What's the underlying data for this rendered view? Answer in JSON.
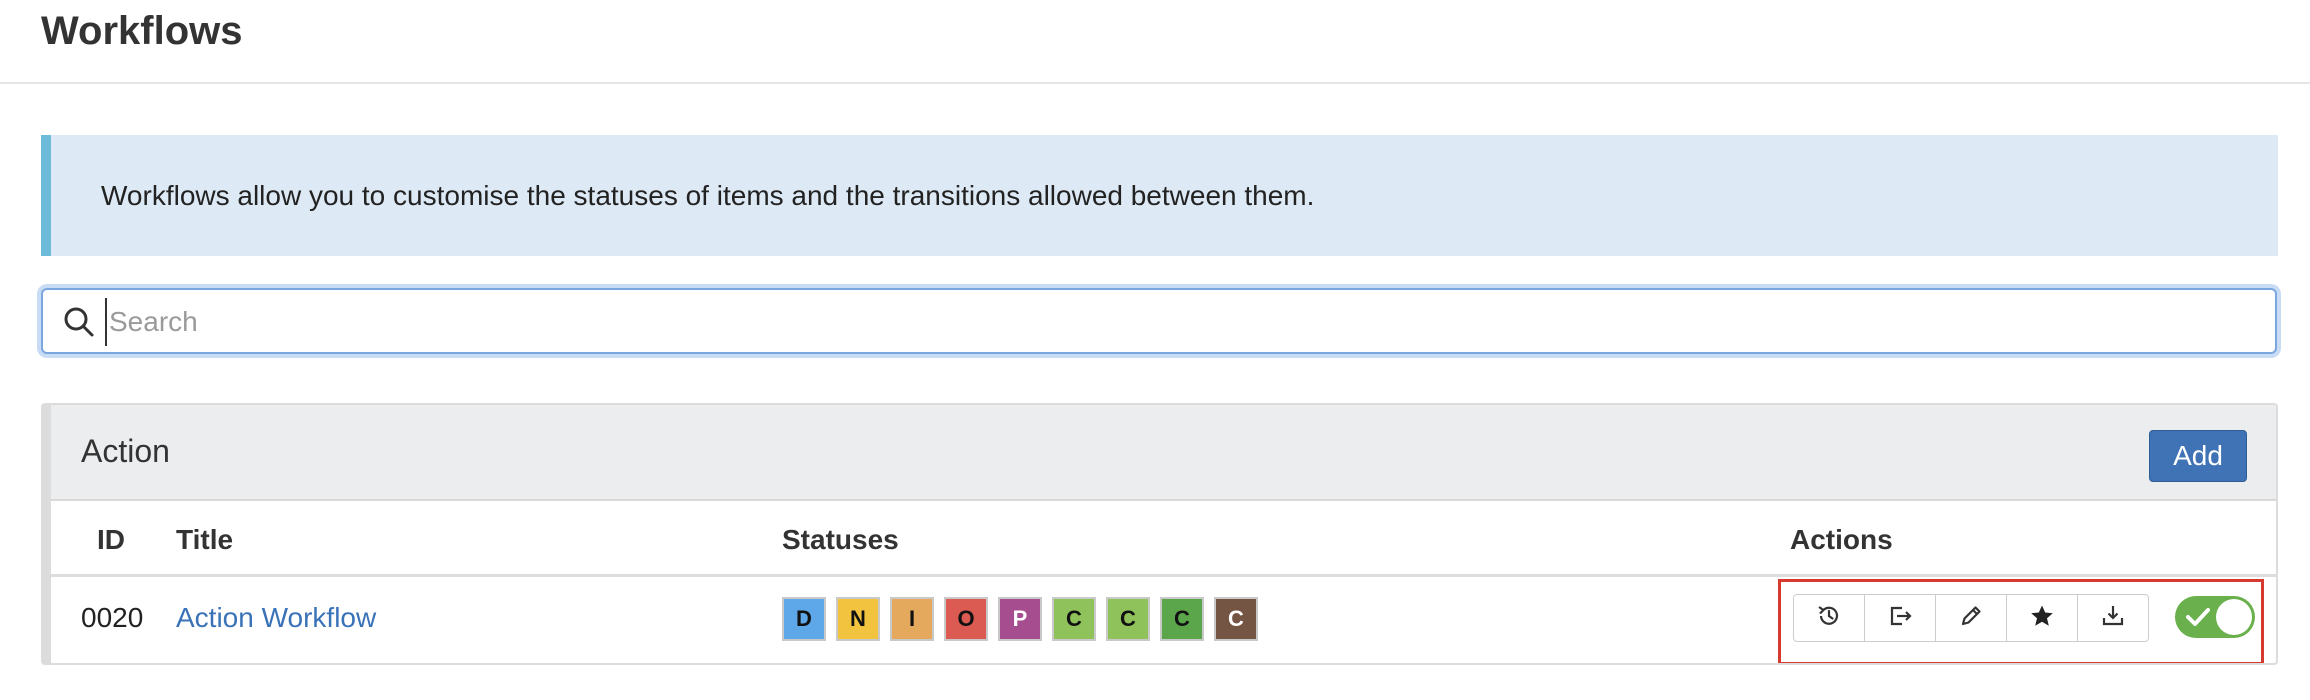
{
  "page": {
    "title": "Workflows"
  },
  "info": {
    "text": "Workflows allow you to customise the statuses of items and the transitions allowed between them."
  },
  "search": {
    "placeholder": "Search",
    "value": ""
  },
  "panel": {
    "title": "Action",
    "add_label": "Add",
    "columns": {
      "id": "ID",
      "title": "Title",
      "statuses": "Statuses",
      "actions": "Actions"
    },
    "rows": [
      {
        "id": "0020",
        "title": "Action Workflow",
        "statuses": [
          {
            "letter": "D",
            "bg": "#5ea7e8",
            "fg": "#111111"
          },
          {
            "letter": "N",
            "bg": "#f2c33f",
            "fg": "#111111"
          },
          {
            "letter": "I",
            "bg": "#e5a95e",
            "fg": "#111111"
          },
          {
            "letter": "O",
            "bg": "#db5a51",
            "fg": "#111111"
          },
          {
            "letter": "P",
            "bg": "#a64d8f",
            "fg": "#ffffff"
          },
          {
            "letter": "C",
            "bg": "#8fc25b",
            "fg": "#111111"
          },
          {
            "letter": "C",
            "bg": "#8fc25b",
            "fg": "#111111"
          },
          {
            "letter": "C",
            "bg": "#5ba64b",
            "fg": "#111111"
          },
          {
            "letter": "C",
            "bg": "#745443",
            "fg": "#ffffff"
          }
        ],
        "actions": [
          {
            "icon": "history-icon"
          },
          {
            "icon": "export-icon"
          },
          {
            "icon": "pencil-icon"
          },
          {
            "icon": "star-icon"
          },
          {
            "icon": "download-icon"
          }
        ],
        "enabled": true
      }
    ]
  },
  "colors": {
    "primary": "#3f73b5",
    "info_bg": "#dde9f4",
    "info_accent": "#6cbbd9",
    "toggle_on": "#6ab04c",
    "highlight": "#d63a2e",
    "link": "#3a72b8"
  }
}
